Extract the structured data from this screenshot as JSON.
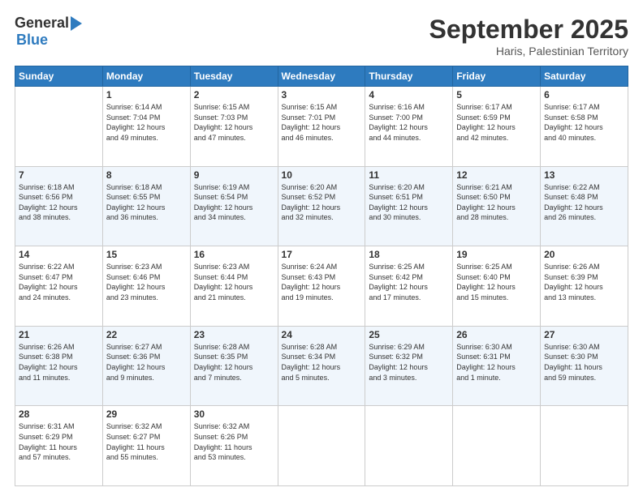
{
  "logo": {
    "general": "General",
    "blue": "Blue"
  },
  "title": "September 2025",
  "location": "Haris, Palestinian Territory",
  "days": [
    "Sunday",
    "Monday",
    "Tuesday",
    "Wednesday",
    "Thursday",
    "Friday",
    "Saturday"
  ],
  "weeks": [
    [
      {
        "num": "",
        "info": ""
      },
      {
        "num": "1",
        "info": "Sunrise: 6:14 AM\nSunset: 7:04 PM\nDaylight: 12 hours\nand 49 minutes."
      },
      {
        "num": "2",
        "info": "Sunrise: 6:15 AM\nSunset: 7:03 PM\nDaylight: 12 hours\nand 47 minutes."
      },
      {
        "num": "3",
        "info": "Sunrise: 6:15 AM\nSunset: 7:01 PM\nDaylight: 12 hours\nand 46 minutes."
      },
      {
        "num": "4",
        "info": "Sunrise: 6:16 AM\nSunset: 7:00 PM\nDaylight: 12 hours\nand 44 minutes."
      },
      {
        "num": "5",
        "info": "Sunrise: 6:17 AM\nSunset: 6:59 PM\nDaylight: 12 hours\nand 42 minutes."
      },
      {
        "num": "6",
        "info": "Sunrise: 6:17 AM\nSunset: 6:58 PM\nDaylight: 12 hours\nand 40 minutes."
      }
    ],
    [
      {
        "num": "7",
        "info": "Sunrise: 6:18 AM\nSunset: 6:56 PM\nDaylight: 12 hours\nand 38 minutes."
      },
      {
        "num": "8",
        "info": "Sunrise: 6:18 AM\nSunset: 6:55 PM\nDaylight: 12 hours\nand 36 minutes."
      },
      {
        "num": "9",
        "info": "Sunrise: 6:19 AM\nSunset: 6:54 PM\nDaylight: 12 hours\nand 34 minutes."
      },
      {
        "num": "10",
        "info": "Sunrise: 6:20 AM\nSunset: 6:52 PM\nDaylight: 12 hours\nand 32 minutes."
      },
      {
        "num": "11",
        "info": "Sunrise: 6:20 AM\nSunset: 6:51 PM\nDaylight: 12 hours\nand 30 minutes."
      },
      {
        "num": "12",
        "info": "Sunrise: 6:21 AM\nSunset: 6:50 PM\nDaylight: 12 hours\nand 28 minutes."
      },
      {
        "num": "13",
        "info": "Sunrise: 6:22 AM\nSunset: 6:48 PM\nDaylight: 12 hours\nand 26 minutes."
      }
    ],
    [
      {
        "num": "14",
        "info": "Sunrise: 6:22 AM\nSunset: 6:47 PM\nDaylight: 12 hours\nand 24 minutes."
      },
      {
        "num": "15",
        "info": "Sunrise: 6:23 AM\nSunset: 6:46 PM\nDaylight: 12 hours\nand 23 minutes."
      },
      {
        "num": "16",
        "info": "Sunrise: 6:23 AM\nSunset: 6:44 PM\nDaylight: 12 hours\nand 21 minutes."
      },
      {
        "num": "17",
        "info": "Sunrise: 6:24 AM\nSunset: 6:43 PM\nDaylight: 12 hours\nand 19 minutes."
      },
      {
        "num": "18",
        "info": "Sunrise: 6:25 AM\nSunset: 6:42 PM\nDaylight: 12 hours\nand 17 minutes."
      },
      {
        "num": "19",
        "info": "Sunrise: 6:25 AM\nSunset: 6:40 PM\nDaylight: 12 hours\nand 15 minutes."
      },
      {
        "num": "20",
        "info": "Sunrise: 6:26 AM\nSunset: 6:39 PM\nDaylight: 12 hours\nand 13 minutes."
      }
    ],
    [
      {
        "num": "21",
        "info": "Sunrise: 6:26 AM\nSunset: 6:38 PM\nDaylight: 12 hours\nand 11 minutes."
      },
      {
        "num": "22",
        "info": "Sunrise: 6:27 AM\nSunset: 6:36 PM\nDaylight: 12 hours\nand 9 minutes."
      },
      {
        "num": "23",
        "info": "Sunrise: 6:28 AM\nSunset: 6:35 PM\nDaylight: 12 hours\nand 7 minutes."
      },
      {
        "num": "24",
        "info": "Sunrise: 6:28 AM\nSunset: 6:34 PM\nDaylight: 12 hours\nand 5 minutes."
      },
      {
        "num": "25",
        "info": "Sunrise: 6:29 AM\nSunset: 6:32 PM\nDaylight: 12 hours\nand 3 minutes."
      },
      {
        "num": "26",
        "info": "Sunrise: 6:30 AM\nSunset: 6:31 PM\nDaylight: 12 hours\nand 1 minute."
      },
      {
        "num": "27",
        "info": "Sunrise: 6:30 AM\nSunset: 6:30 PM\nDaylight: 11 hours\nand 59 minutes."
      }
    ],
    [
      {
        "num": "28",
        "info": "Sunrise: 6:31 AM\nSunset: 6:29 PM\nDaylight: 11 hours\nand 57 minutes."
      },
      {
        "num": "29",
        "info": "Sunrise: 6:32 AM\nSunset: 6:27 PM\nDaylight: 11 hours\nand 55 minutes."
      },
      {
        "num": "30",
        "info": "Sunrise: 6:32 AM\nSunset: 6:26 PM\nDaylight: 11 hours\nand 53 minutes."
      },
      {
        "num": "",
        "info": ""
      },
      {
        "num": "",
        "info": ""
      },
      {
        "num": "",
        "info": ""
      },
      {
        "num": "",
        "info": ""
      }
    ]
  ]
}
